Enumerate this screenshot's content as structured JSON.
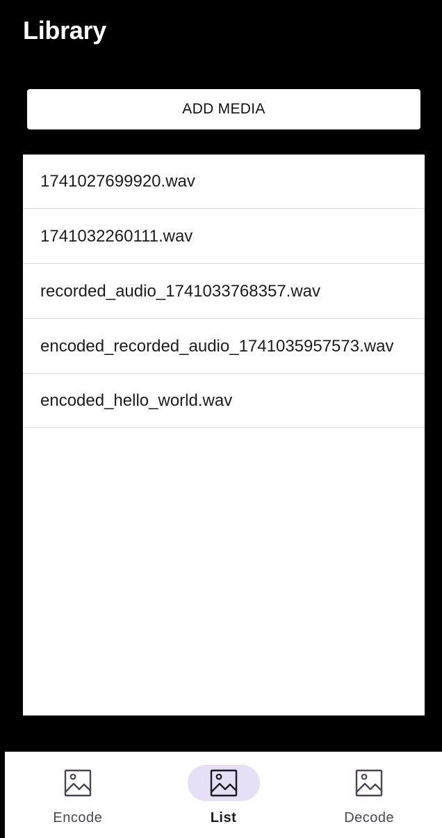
{
  "header": {
    "title": "Library"
  },
  "actions": {
    "add_media_label": "ADD MEDIA"
  },
  "media_list": {
    "items": [
      "1741027699920.wav",
      "1741032260111.wav",
      "recorded_audio_1741033768357.wav",
      "encoded_recorded_audio_1741035957573.wav",
      "encoded_hello_world.wav"
    ]
  },
  "bottom_nav": {
    "items": [
      {
        "label": "Encode",
        "icon": "image-icon",
        "active": false
      },
      {
        "label": "List",
        "icon": "image-icon",
        "active": true
      },
      {
        "label": "Decode",
        "icon": "image-icon",
        "active": false
      }
    ],
    "active_indicator_color": "#e6dff5"
  }
}
